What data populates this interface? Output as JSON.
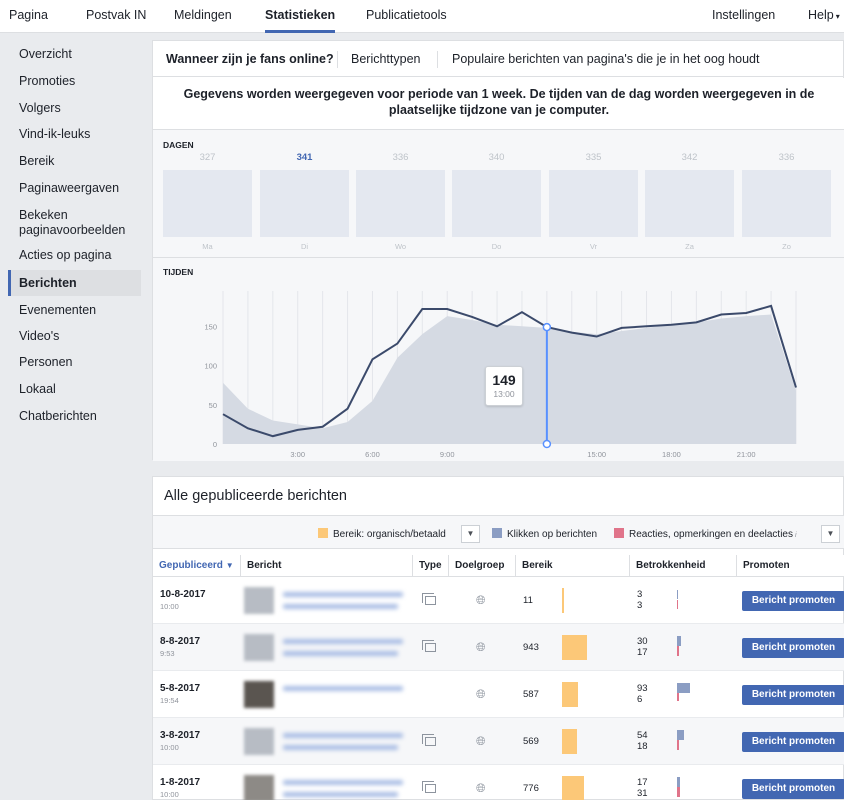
{
  "topnav": {
    "items": [
      "Pagina",
      "Postvak IN",
      "Meldingen",
      "Statistieken",
      "Publicatietools"
    ],
    "active": "Statistieken",
    "right": [
      "Instellingen",
      "Help"
    ]
  },
  "sidebar": {
    "items": [
      "Overzicht",
      "Promoties",
      "Volgers",
      "Vind-ik-leuks",
      "Bereik",
      "Paginaweergaven",
      "Bekeken paginavoorbeelden",
      "Acties op pagina",
      "Berichten",
      "Evenementen",
      "Video's",
      "Personen",
      "Lokaal",
      "Chatberichten"
    ],
    "active": "Berichten"
  },
  "tabs": [
    "Wanneer zijn je fans online?",
    "Berichttypen",
    "Populaire berichten van pagina's die je in het oog houdt"
  ],
  "notice": "Gegevens worden weergegeven voor periode van 1 week. De tijden van de dag worden weergegeven in de plaatselijke tijdzone van je computer.",
  "days": {
    "label": "DAGEN",
    "items": [
      {
        "name": "Ma",
        "value": "327"
      },
      {
        "name": "Di",
        "value": "341"
      },
      {
        "name": "Wo",
        "value": "336"
      },
      {
        "name": "Do",
        "value": "340"
      },
      {
        "name": "Vr",
        "value": "335"
      },
      {
        "name": "Za",
        "value": "342"
      },
      {
        "name": "Zo",
        "value": "336"
      }
    ],
    "highlight": "Di"
  },
  "times": {
    "label": "TIJDEN",
    "tooltip": {
      "value": "149",
      "time": "13:00"
    }
  },
  "chart_data": {
    "type": "line",
    "x": [
      "0:00",
      "1:00",
      "2:00",
      "3:00",
      "4:00",
      "5:00",
      "6:00",
      "7:00",
      "8:00",
      "9:00",
      "10:00",
      "11:00",
      "12:00",
      "13:00",
      "14:00",
      "15:00",
      "16:00",
      "17:00",
      "18:00",
      "19:00",
      "20:00",
      "21:00",
      "22:00",
      "23:00"
    ],
    "x_tick_labels": [
      "3:00",
      "6:00",
      "9:00",
      "15:00",
      "18:00",
      "21:00"
    ],
    "y_ticks": [
      0,
      50,
      100,
      150
    ],
    "ylim": [
      0,
      195
    ],
    "series": [
      {
        "values": [
          38,
          20,
          10,
          18,
          22,
          45,
          108,
          128,
          172,
          172,
          162,
          150,
          168,
          149,
          142,
          137,
          148,
          150,
          152,
          155,
          165,
          167,
          176,
          72
        ]
      },
      {
        "values": [
          78,
          45,
          30,
          25,
          20,
          28,
          55,
          110,
          140,
          163,
          158,
          152,
          150,
          148,
          143,
          140,
          144,
          148,
          152,
          155,
          160,
          163,
          165,
          68
        ]
      }
    ],
    "highlight": {
      "x": "13:00",
      "value": 149
    }
  },
  "posts": {
    "title": "Alle gepubliceerde berichten",
    "legend": [
      {
        "label": "Bereik: organisch/betaald",
        "color": "#fcc878"
      },
      {
        "label": "Klikken op berichten",
        "color": "#8b9dc3"
      },
      {
        "label": "Reacties, opmerkingen en deelacties",
        "color": "#e0748a"
      }
    ],
    "columns": [
      "Gepubliceerd",
      "Bericht",
      "Type",
      "Doelgroep",
      "Bereik",
      "Betrokkenheid",
      "Promoten"
    ],
    "sort_col": "Gepubliceerd",
    "rows": [
      {
        "date": "10-8-2017",
        "time": "10:00",
        "reach": "11",
        "clicks": "3",
        "reactions": "3",
        "promote": "Bericht promoten"
      },
      {
        "date": "8-8-2017",
        "time": "9:53",
        "reach": "943",
        "clicks": "30",
        "reactions": "17",
        "promote": "Bericht promoten"
      },
      {
        "date": "5-8-2017",
        "time": "19:54",
        "reach": "587",
        "clicks": "93",
        "reactions": "6",
        "promote": "Bericht promoten"
      },
      {
        "date": "3-8-2017",
        "time": "10:00",
        "reach": "569",
        "clicks": "54",
        "reactions": "18",
        "promote": "Bericht promoten"
      },
      {
        "date": "1-8-2017",
        "time": "10:00",
        "reach": "776",
        "clicks": "17",
        "reactions": "31",
        "promote": "Bericht promoten"
      }
    ]
  }
}
